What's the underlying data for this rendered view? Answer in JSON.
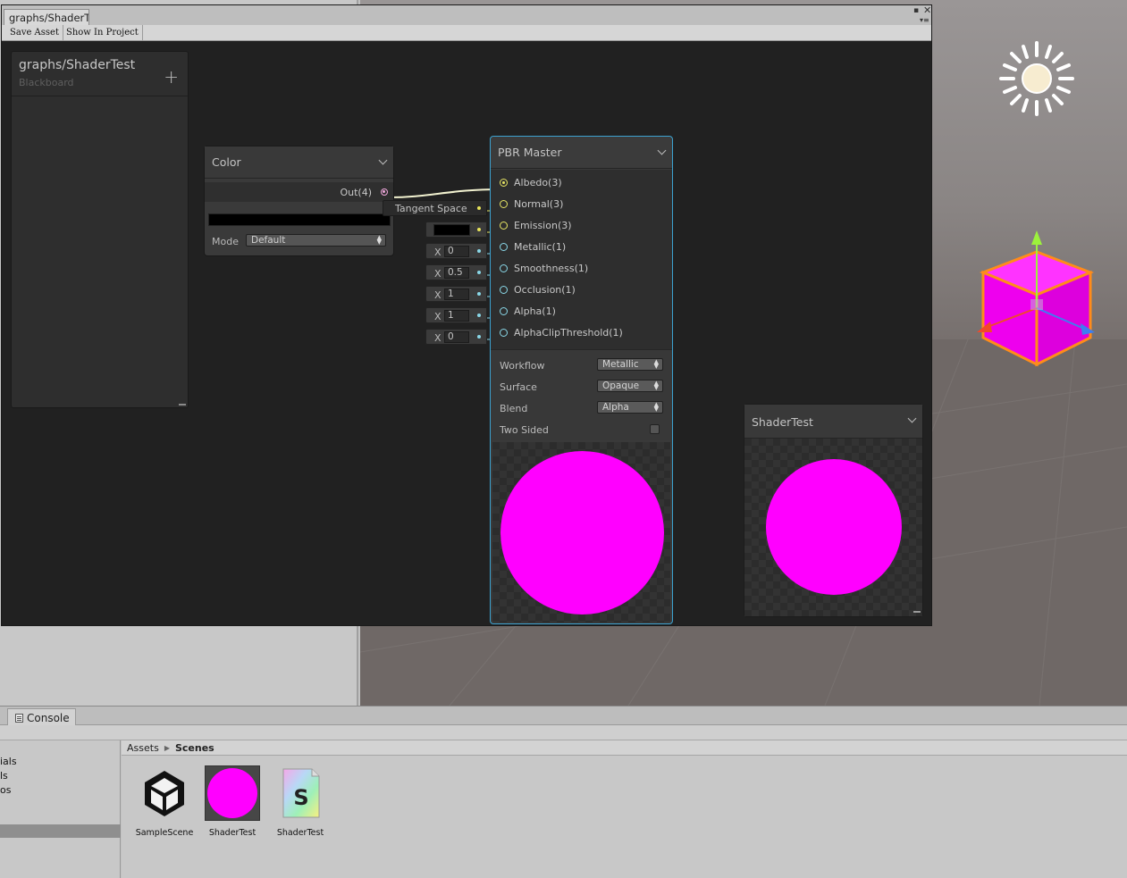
{
  "window": {
    "tab_title": "graphs/ShaderT"
  },
  "toolbar": {
    "save_asset": "Save Asset",
    "show_in_project": "Show In Project"
  },
  "blackboard": {
    "title": "graphs/ShaderTest",
    "subtitle": "Blackboard",
    "add_symbol": "+"
  },
  "color_node": {
    "title": "Color",
    "output_label": "Out(4)",
    "mode_label": "Mode",
    "mode_value": "Default",
    "swatch_color": "#000000"
  },
  "tangent_space": "Tangent Space",
  "inline_inputs": {
    "metallic": {
      "x": "X",
      "value": "0"
    },
    "smoothness": {
      "x": "X",
      "value": "0.5"
    },
    "occlusion": {
      "x": "X",
      "value": "1"
    },
    "alpha": {
      "x": "X",
      "value": "1"
    },
    "alpha_clip": {
      "x": "X",
      "value": "0"
    }
  },
  "pbr_master": {
    "title": "PBR Master",
    "ports": [
      "Albedo(3)",
      "Normal(3)",
      "Emission(3)",
      "Metallic(1)",
      "Smoothness(1)",
      "Occlusion(1)",
      "Alpha(1)",
      "AlphaClipThreshold(1)"
    ],
    "settings": {
      "workflow_label": "Workflow",
      "workflow_value": "Metallic",
      "surface_label": "Surface",
      "surface_value": "Opaque",
      "blend_label": "Blend",
      "blend_value": "Alpha",
      "two_sided_label": "Two Sided"
    },
    "preview_color": "#ff00ff"
  },
  "main_preview": {
    "title": "ShaderTest"
  },
  "console": {
    "tab_label": "Console"
  },
  "project": {
    "tree_items": [
      "ials",
      "ls",
      "os"
    ],
    "breadcrumb_root": "Assets",
    "breadcrumb_current": "Scenes",
    "assets": [
      {
        "label": "SampleScene",
        "icon": "unity-logo-icon"
      },
      {
        "label": "ShaderTest",
        "icon": "material-sphere-icon"
      },
      {
        "label": "ShaderTest",
        "icon": "shader-file-icon"
      }
    ]
  },
  "colors": {
    "accent_selection": "#3ca2d0",
    "preview_magenta": "#ff00ff",
    "vector3_port": "#e6e464",
    "vector1_port": "#8ad8e8",
    "color_port": "#f0a8dc"
  }
}
